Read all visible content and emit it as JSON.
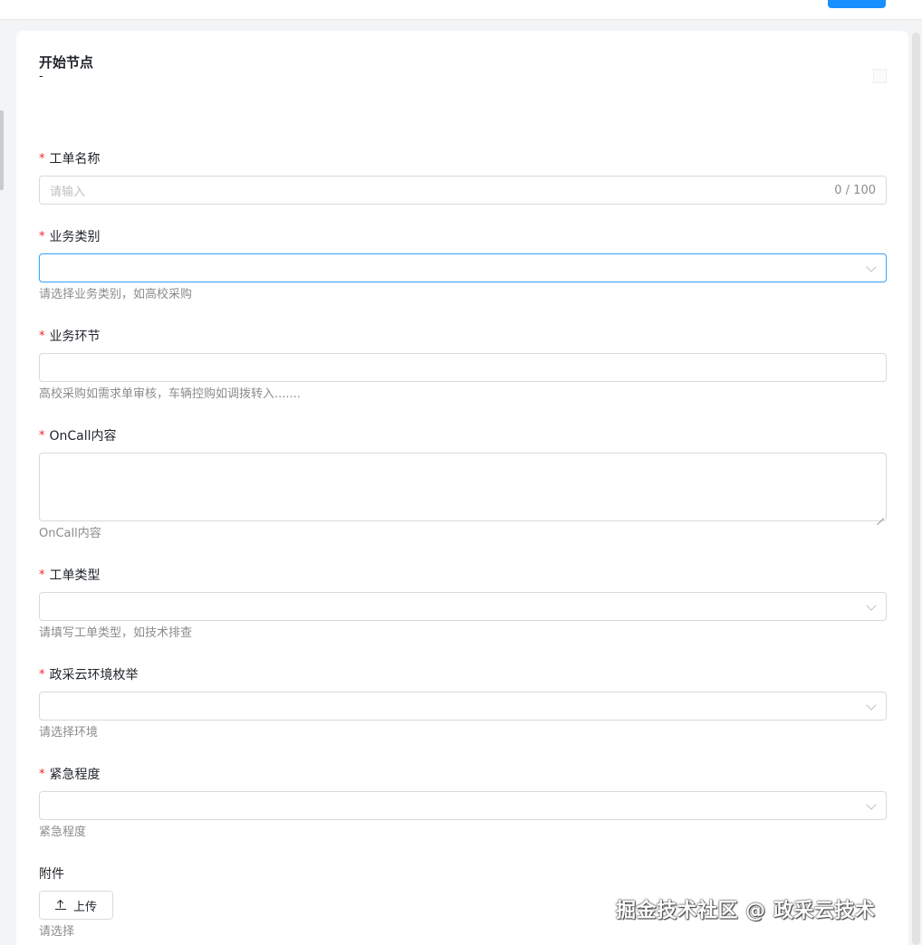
{
  "node": {
    "title": "开始节点",
    "subtitle": "-"
  },
  "form": {
    "ticket_name": {
      "label": "工单名称",
      "required_mark": "*",
      "placeholder": "请输入",
      "counter": "0 / 100"
    },
    "business_category": {
      "label": "业务类别",
      "required_mark": "*",
      "help": "请选择业务类别，如高校采购",
      "icon": "chevron-down-icon"
    },
    "business_stage": {
      "label": "业务环节",
      "required_mark": "*",
      "help": "高校采购如需求单审核，车辆控购如调拨转入......."
    },
    "oncall_content": {
      "label": "OnCall内容",
      "required_mark": "*",
      "help": "OnCall内容"
    },
    "ticket_type": {
      "label": "工单类型",
      "required_mark": "*",
      "help": "请填写工单类型，如技术排查",
      "icon": "chevron-down-icon"
    },
    "environment": {
      "label": "政采云环境枚举",
      "required_mark": "*",
      "help": "请选择环境",
      "icon": "chevron-down-icon"
    },
    "urgency": {
      "label": "紧急程度",
      "required_mark": "*",
      "help": "紧急程度",
      "icon": "chevron-down-icon"
    },
    "attachment": {
      "label": "附件",
      "upload_label": "上传",
      "help": "请选择",
      "icon": "upload-icon"
    }
  },
  "watermark": "掘金技术社区 @ 政采云技术",
  "colors": {
    "accent": "#1890ff",
    "required": "#f5222d",
    "focus_border": "#40a9ff",
    "help_text": "#8c8c8c"
  }
}
